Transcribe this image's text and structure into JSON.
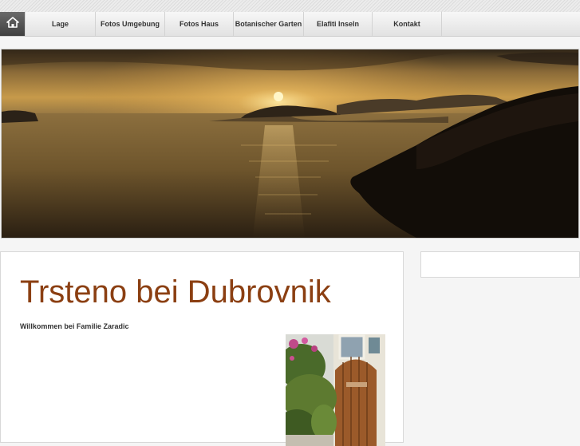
{
  "nav": {
    "home_icon": "home-icon",
    "items": [
      {
        "label": "Lage"
      },
      {
        "label": "Fotos Umgebung"
      },
      {
        "label": "Fotos Haus"
      },
      {
        "label": "Botanischer Garten"
      },
      {
        "label": "Elafiti Inseln"
      },
      {
        "label": "Kontakt"
      }
    ]
  },
  "main": {
    "title": "Trsteno bei Dubrovnik",
    "subtitle": "Willkommen bei Familie Zaradic"
  },
  "colors": {
    "title": "#8b3f12",
    "nav_text": "#333333",
    "home_button": "#4a4a4a"
  }
}
